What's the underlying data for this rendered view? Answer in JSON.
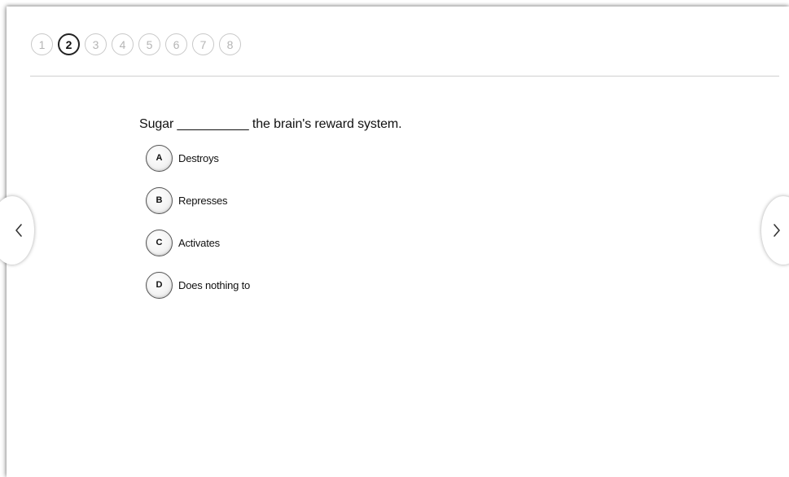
{
  "progress": {
    "steps": [
      "1",
      "2",
      "3",
      "4",
      "5",
      "6",
      "7",
      "8"
    ],
    "current_step": "2"
  },
  "question": {
    "text": "Sugar __________ the brain's reward system."
  },
  "options": [
    {
      "letter": "A",
      "text": "Destroys"
    },
    {
      "letter": "B",
      "text": "Represses"
    },
    {
      "letter": "C",
      "text": "Activates"
    },
    {
      "letter": "D",
      "text": "Does nothing to"
    }
  ],
  "navigation": {
    "prev_icon": "chevron-left-icon",
    "next_icon": "chevron-right-icon"
  },
  "colors": {
    "active_step": "#222222",
    "inactive_step": "#b5b5b5",
    "divider": "#cfcfcf"
  }
}
